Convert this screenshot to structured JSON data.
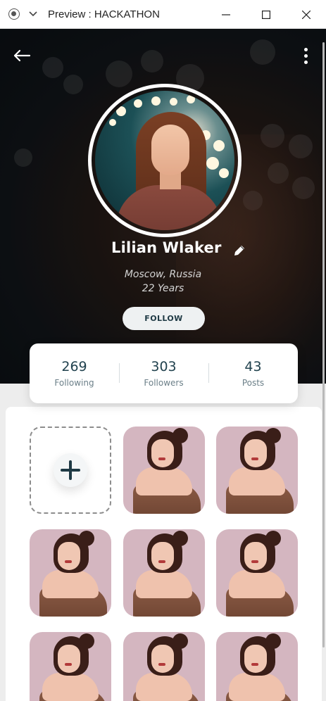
{
  "window": {
    "title": "Preview : HACKATHON",
    "icons": [
      "app-icon",
      "chevron-down-icon",
      "minimize-icon",
      "maximize-icon",
      "close-icon"
    ]
  },
  "header": {
    "icons": [
      "back-arrow-icon",
      "more-vertical-icon"
    ]
  },
  "profile": {
    "name": "Lilian Wlaker",
    "location": "Moscow, Russia",
    "age": "22 Years",
    "follow_label": "FOLLOW",
    "edit_icon": "pencil-icon"
  },
  "stats": [
    {
      "value": "269",
      "label": "Following"
    },
    {
      "value": "303",
      "label": "Followers"
    },
    {
      "value": "43",
      "label": "Posts"
    }
  ],
  "gallery": {
    "add_icon": "plus-icon",
    "photo_count": 8
  },
  "colors": {
    "accent": "#1f3a45",
    "follow_bg": "#eef1f2",
    "panel_bg": "#ededed",
    "photo_bg": "#d4b6c0"
  }
}
